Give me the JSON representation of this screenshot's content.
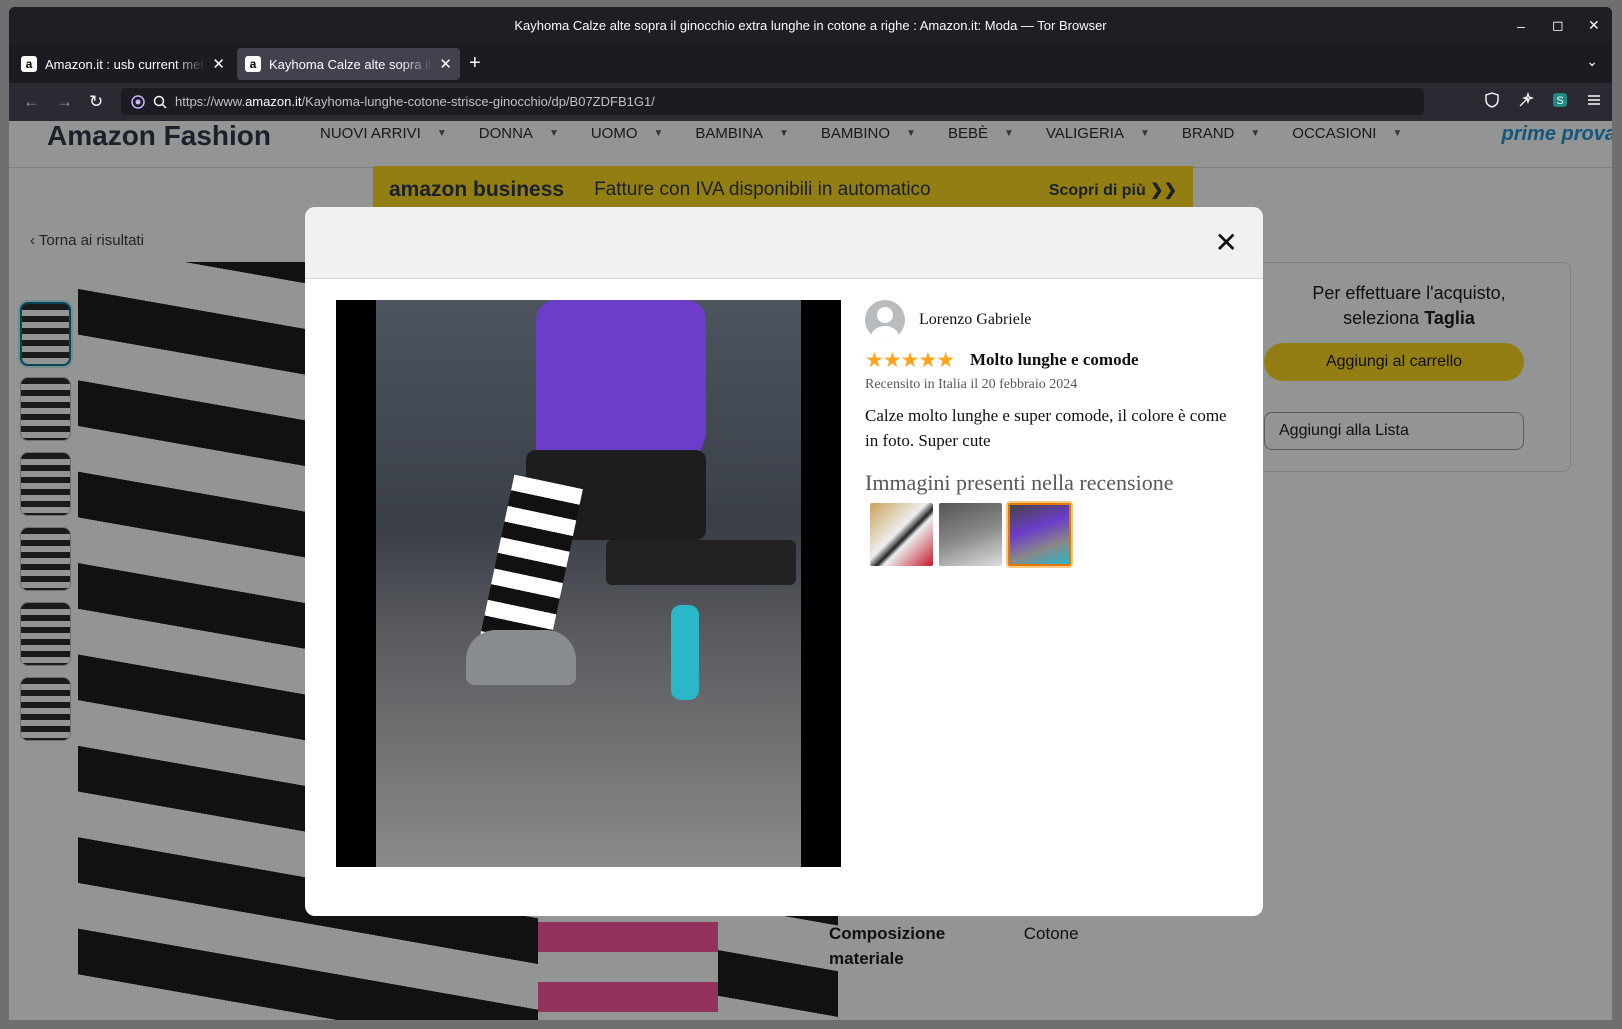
{
  "window": {
    "title": "Kayhoma Calze alte sopra il ginocchio extra lunghe in cotone a righe : Amazon.it: Moda — Tor Browser",
    "controls": [
      "–",
      "◻",
      "✕"
    ]
  },
  "tabs": [
    {
      "label": "Amazon.it : usb current meter",
      "favicon": "a"
    },
    {
      "label": "Kayhoma Calze alte sopra il ginocchio",
      "favicon": "a"
    }
  ],
  "tab_close": "✕",
  "new_tab": "+",
  "tab_list": "⌄",
  "nav": {
    "back": "←",
    "forward": "→",
    "reload": "↻",
    "url_prefix": "https://www.",
    "url_domain": "amazon.it",
    "url_path": "/Kayhoma-lunghe-cotone-strisce-ginocchio/dp/B07ZDFB1G1/"
  },
  "page": {
    "brand": "Amazon Fashion",
    "menu": [
      "NUOVI ARRIVI",
      "DONNA",
      "UOMO",
      "BAMBINA",
      "BAMBINO",
      "BEBÈ",
      "VALIGERIA",
      "BRAND",
      "OCCASIONI"
    ],
    "prime": "prime prova",
    "banner": {
      "logo": "amazon business",
      "text": "Fatture con IVA disponibili in automatico",
      "cta": "Scopri di più ❯❯"
    },
    "back_link": "‹  Torna ai risultati",
    "buybox": {
      "prompt_line1": "Per effettuare l'acquisto,",
      "prompt_pre": "seleziona ",
      "prompt_bold": "Taglia",
      "cart_button": "Aggiungi al carrello",
      "list_button": "Aggiungi alla Lista"
    },
    "details": [
      {
        "key": "Composizione materiale",
        "value": "Cotone"
      }
    ]
  },
  "modal": {
    "close": "✕",
    "reviewer": "Lorenzo Gabriele",
    "rating": 5,
    "stars": "★★★★★",
    "title": "Molto lunghe e comode",
    "date": "Recensito in Italia il 20 febbraio 2024",
    "body": "Calze molto lunghe e super comode, il colore è come in foto. Super cute",
    "images_heading": "Immagini presenti nella recensione",
    "selected_image": 3
  }
}
